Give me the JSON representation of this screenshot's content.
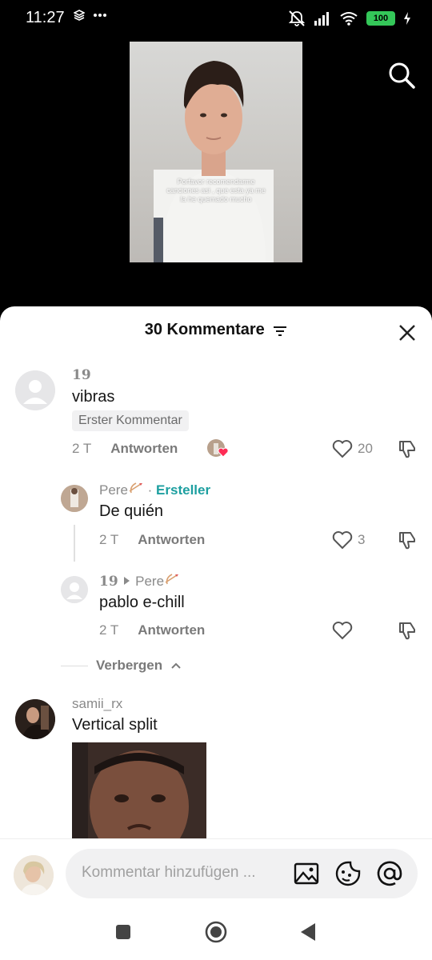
{
  "status": {
    "time": "11:27",
    "battery": "100"
  },
  "video": {
    "caption": "Porfavor recomendarme canciones asi , que esta ya me la he quemado mucho"
  },
  "sheet": {
    "title": "30 Kommentare"
  },
  "comments": [
    {
      "name": "19",
      "text": "vibras",
      "chip": "Erster Kommentar",
      "time": "2 T",
      "reply": "Antworten",
      "likes": "20"
    },
    {
      "name": "Pere",
      "creator": "Ersteller",
      "text": "De quién",
      "time": "2 T",
      "reply": "Antworten",
      "likes": "3"
    },
    {
      "name": "19",
      "reply_to": "Pere",
      "text": "pablo e-chill",
      "time": "2 T",
      "reply": "Antworten"
    },
    {
      "name": "samii_rx",
      "text": "Vertical split"
    }
  ],
  "hide_replies": "Verbergen",
  "composer": {
    "placeholder": "Kommentar hinzufügen ..."
  },
  "icons": {
    "search": "search-icon",
    "close": "close-icon",
    "filter": "filter-icon",
    "heart": "heart-icon",
    "dislike": "thumbs-down-icon",
    "image": "image-icon",
    "emoji": "emoji-icon",
    "mention": "at-icon",
    "bow": "bow-arrow-emoji"
  },
  "colors": {
    "accent_creator": "#1d9fa0",
    "like_heart_red": "#fe2c55",
    "battery_green": "#34c759"
  }
}
